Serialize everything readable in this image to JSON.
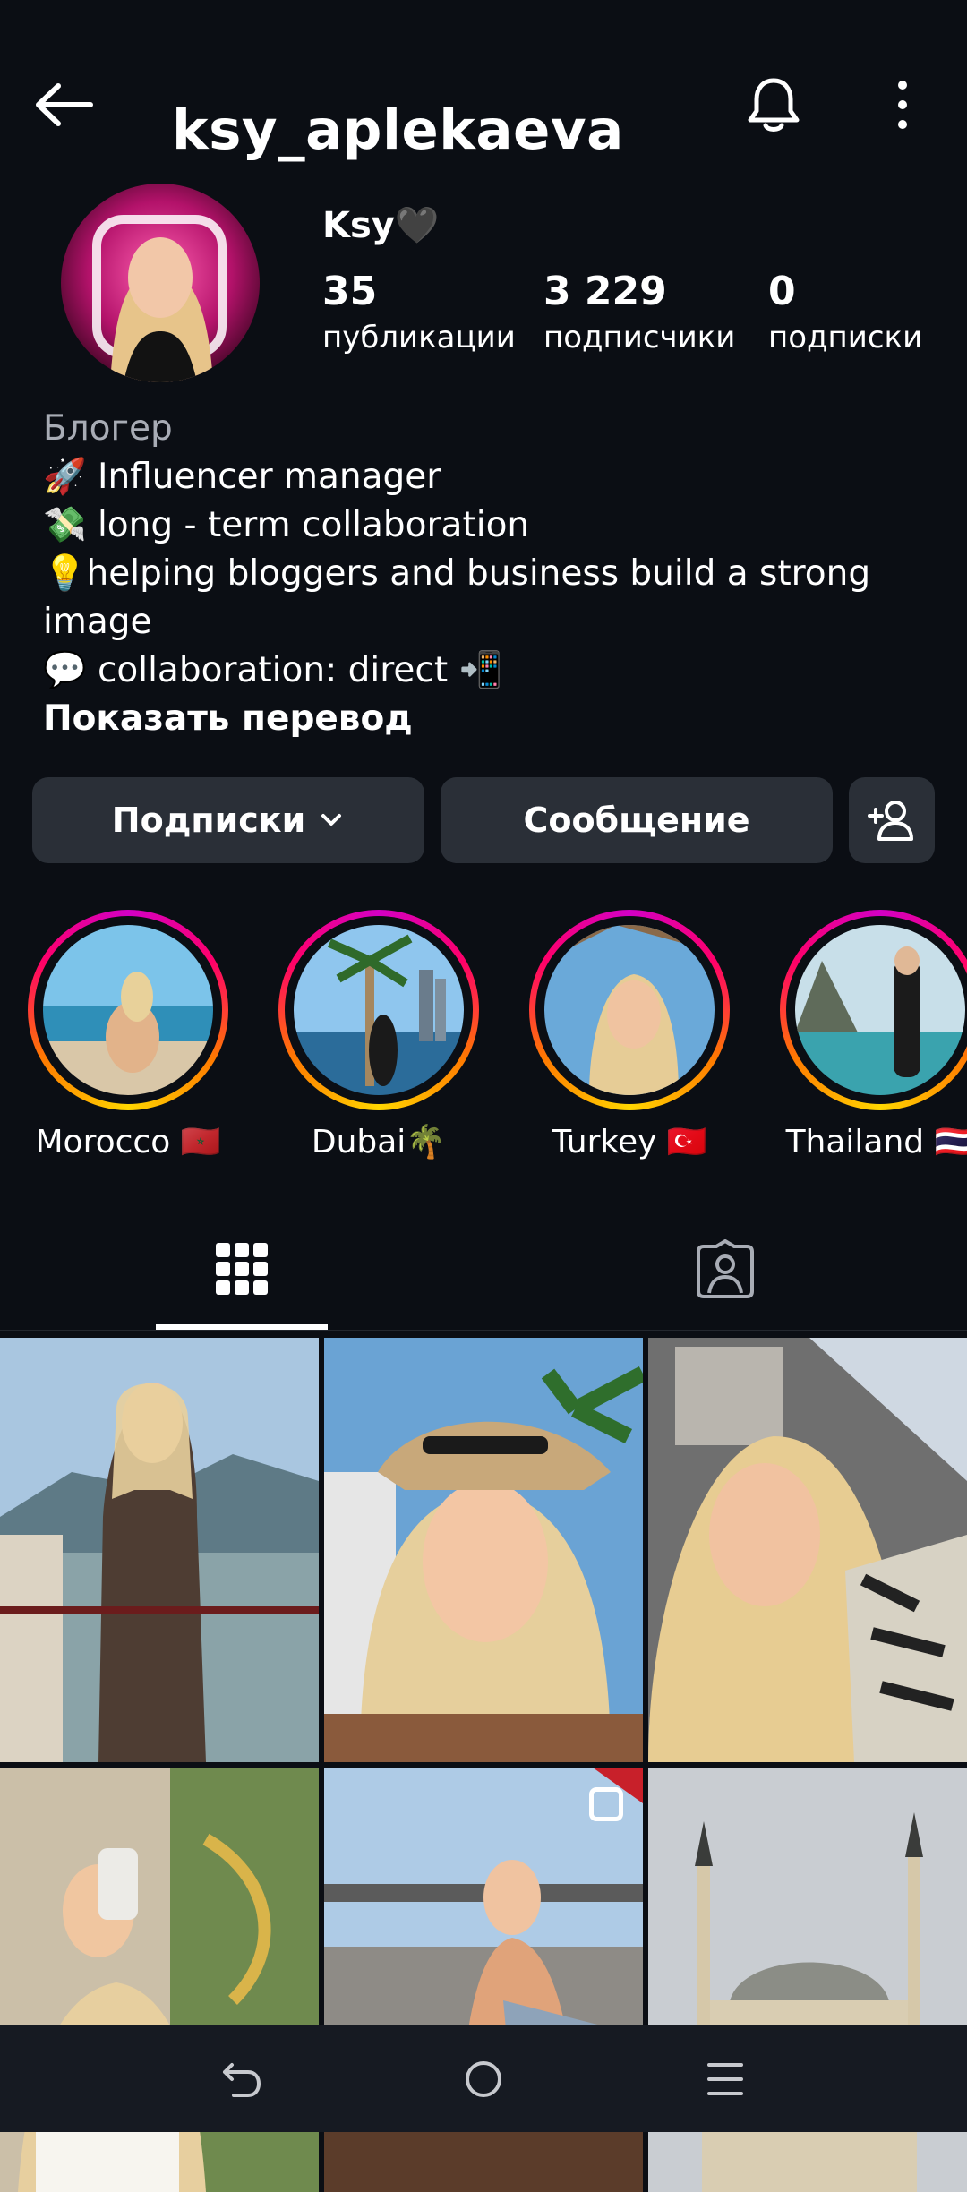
{
  "header": {
    "username": "ksy_aplekaeva",
    "back_icon": "arrow-left-icon",
    "bell_icon": "bell-icon",
    "more_icon": "more-vertical-icon"
  },
  "profile": {
    "display_name": "Ksy🖤",
    "stats": [
      {
        "value": "35",
        "label": "публикации"
      },
      {
        "value": "3 229",
        "label": "подписчики"
      },
      {
        "value": "0",
        "label": "подписки"
      }
    ]
  },
  "bio": {
    "category": "Блогер",
    "lines": [
      "🚀 Influencer manager",
      "💸 long - term collaboration",
      "💡helping bloggers and business build a strong image",
      "💬 collaboration: direct 📲"
    ],
    "translate_label": "Показать перевод"
  },
  "actions": {
    "following_label": "Подписки",
    "message_label": "Сообщение",
    "add_user_icon": "add-person-icon"
  },
  "highlights": [
    {
      "label": "Morocco 🇲🇦"
    },
    {
      "label": "Dubai🌴"
    },
    {
      "label": "Turkey 🇹🇷"
    },
    {
      "label": "Thailand 🇹🇭"
    }
  ],
  "tabs": [
    {
      "name": "posts",
      "icon": "grid-icon"
    },
    {
      "name": "tagged",
      "icon": "tagged-person-icon"
    }
  ],
  "navbar": {
    "back_icon": "nav-back-icon",
    "home_icon": "nav-home-icon",
    "recents_icon": "nav-recents-icon"
  },
  "colors": {
    "background": "#0b0e14",
    "button": "#2a2f37",
    "secondary_text": "#a8acb5",
    "ring_start": "#d300c5",
    "ring_end": "#ffd600"
  }
}
